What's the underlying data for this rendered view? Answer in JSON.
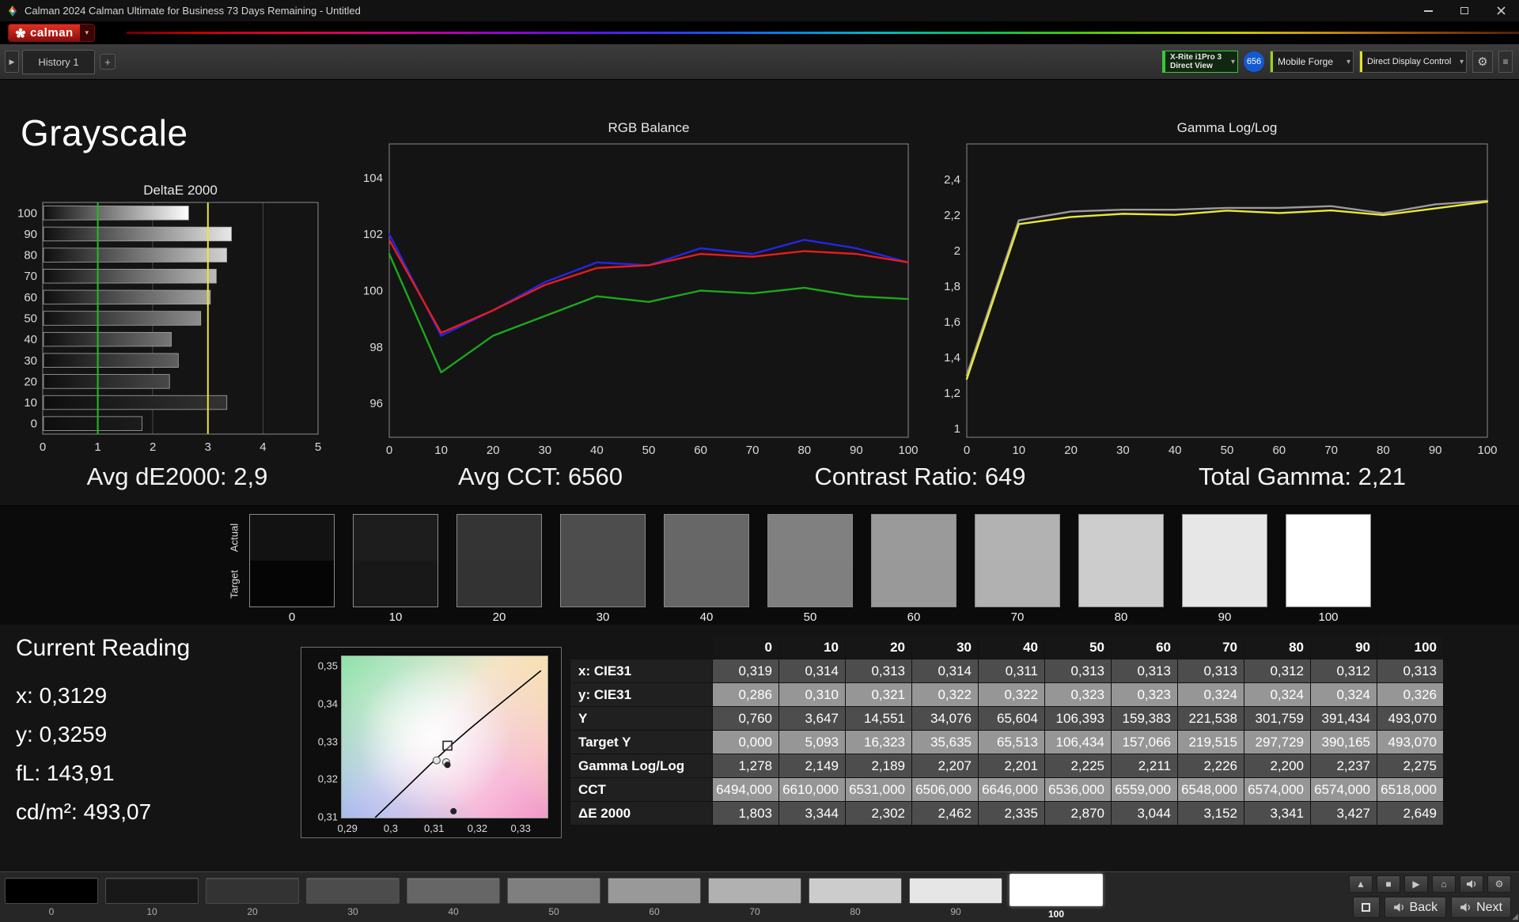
{
  "window": {
    "title": "Calman 2024 Calman Ultimate for Business 73 Days Remaining  - Untitled"
  },
  "brand": {
    "logo_text": "calman"
  },
  "icons": {
    "play": "▶",
    "stop": "■",
    "eject": "▲",
    "home": "⌂",
    "gear": "⚙",
    "menu": "≡",
    "chevron_down": "▾",
    "collapse": "▶",
    "grip": "◢"
  },
  "toolbar": {
    "history_tab": "History 1",
    "add_tab_label": "+",
    "meter_select": {
      "line1": "X-Rite i1Pro 3",
      "line2": "Direct View"
    },
    "meter_badge": "656",
    "source_select": "Mobile Forge",
    "control_select": "Direct Display Control"
  },
  "page": {
    "title": "Grayscale",
    "summary": [
      "Avg dE2000: 2,9",
      "Avg CCT: 6560",
      "Contrast Ratio: 649",
      "Total Gamma: 2,21"
    ]
  },
  "chart_data": [
    {
      "type": "bar",
      "title": "DeltaE 2000",
      "orientation": "horizontal",
      "categories": [
        100,
        90,
        80,
        70,
        60,
        50,
        40,
        30,
        20,
        10,
        0
      ],
      "values": [
        2.649,
        3.427,
        3.341,
        3.152,
        3.044,
        2.87,
        2.335,
        2.462,
        2.302,
        3.344,
        1.803
      ],
      "xlim": [
        0,
        5
      ],
      "xticks": [
        0,
        1,
        2,
        3,
        4,
        5
      ],
      "reference_lines": [
        {
          "x": 1,
          "color": "#1fbf1f"
        },
        {
          "x": 3,
          "color": "#e8e83a"
        }
      ]
    },
    {
      "type": "line",
      "title": "RGB Balance",
      "x": [
        0,
        10,
        20,
        30,
        40,
        50,
        60,
        70,
        80,
        90,
        100
      ],
      "xticks": [
        0,
        10,
        20,
        30,
        40,
        50,
        60,
        70,
        80,
        90,
        100
      ],
      "ylim": [
        94.8,
        105.2
      ],
      "yticks": [
        96,
        98,
        100,
        102,
        104
      ],
      "ytick_labels": [
        "96",
        "98",
        "100",
        "102",
        "104"
      ],
      "series": [
        {
          "name": "green",
          "color": "#1da81d",
          "values": [
            101.3,
            97.1,
            98.4,
            99.1,
            99.8,
            99.6,
            100.0,
            99.9,
            100.1,
            99.8,
            99.7
          ]
        },
        {
          "name": "blue",
          "color": "#2525e8",
          "values": [
            102.0,
            98.4,
            99.3,
            100.3,
            101.0,
            100.9,
            101.5,
            101.3,
            101.8,
            101.5,
            101.0
          ]
        },
        {
          "name": "red",
          "color": "#e81c1c",
          "values": [
            101.8,
            98.5,
            99.3,
            100.2,
            100.8,
            100.9,
            101.3,
            101.2,
            101.4,
            101.3,
            101.0
          ]
        }
      ]
    },
    {
      "type": "line",
      "title": "Gamma Log/Log",
      "x": [
        0,
        10,
        20,
        30,
        40,
        50,
        60,
        70,
        80,
        90,
        100
      ],
      "xticks": [
        0,
        10,
        20,
        30,
        40,
        50,
        60,
        70,
        80,
        90,
        100
      ],
      "ylim": [
        0.95,
        2.6
      ],
      "yticks": [
        1,
        1.2,
        1.4,
        1.6,
        1.8,
        2,
        2.2,
        2.4
      ],
      "ytick_labels": [
        "1",
        "1,2",
        "1,4",
        "1,6",
        "1,8",
        "2",
        "2,2",
        "2,4"
      ],
      "series": [
        {
          "name": "target",
          "color": "#9a9a9a",
          "values": [
            1.3,
            2.17,
            2.22,
            2.23,
            2.23,
            2.24,
            2.24,
            2.25,
            2.21,
            2.26,
            2.28
          ]
        },
        {
          "name": "measured",
          "color": "#e8e83a",
          "values": [
            1.278,
            2.149,
            2.189,
            2.207,
            2.201,
            2.225,
            2.211,
            2.226,
            2.2,
            2.237,
            2.275
          ]
        }
      ]
    },
    {
      "type": "scatter",
      "title": "CIE chromaticity",
      "xlim": [
        0.2885,
        0.336
      ],
      "ylim": [
        0.31,
        0.3528
      ],
      "xticks": [
        0.29,
        0.3,
        0.31,
        0.32,
        0.33
      ],
      "xtick_labels": [
        "0,29",
        "0,3",
        "0,31",
        "0,32",
        "0,33"
      ],
      "yticks": [
        0.35,
        0.34,
        0.33,
        0.32,
        0.31
      ],
      "ytick_labels": [
        "0,35",
        "0,34",
        "0,33",
        "0,32",
        "0,31"
      ],
      "curve": [
        [
          0.2962,
          0.31
        ],
        [
          0.3,
          0.3142
        ],
        [
          0.3045,
          0.3192
        ],
        [
          0.309,
          0.3242
        ],
        [
          0.3135,
          0.329
        ],
        [
          0.318,
          0.3335
        ],
        [
          0.3225,
          0.3378
        ],
        [
          0.327,
          0.342
        ],
        [
          0.3315,
          0.3462
        ],
        [
          0.3345,
          0.349
        ]
      ],
      "target_square": [
        0.3129,
        0.3291
      ],
      "measured_circles": [
        [
          0.3104,
          0.3252
        ],
        [
          0.3126,
          0.3247
        ]
      ],
      "dark_dots": [
        [
          0.3129,
          0.324
        ],
        [
          0.3143,
          0.3117
        ]
      ]
    }
  ],
  "patch_row": {
    "row_labels": [
      "Actual",
      "Target"
    ],
    "levels": [
      {
        "label": "0",
        "actual": "#121212",
        "target": "#050505"
      },
      {
        "label": "10",
        "actual": "#1d1d1d",
        "target": "#181818"
      },
      {
        "label": "20",
        "actual": "#343434",
        "target": "#333333"
      },
      {
        "label": "30",
        "actual": "#4d4d4d",
        "target": "#4c4c4c"
      },
      {
        "label": "40",
        "actual": "#676767",
        "target": "#666666"
      },
      {
        "label": "50",
        "actual": "#808080",
        "target": "#7f7f7f"
      },
      {
        "label": "60",
        "actual": "#9a9a9a",
        "target": "#999999"
      },
      {
        "label": "70",
        "actual": "#b2b2b2",
        "target": "#b1b1b1"
      },
      {
        "label": "80",
        "actual": "#cdcdcd",
        "target": "#cccccc"
      },
      {
        "label": "90",
        "actual": "#e7e7e7",
        "target": "#e6e6e6"
      },
      {
        "label": "100",
        "actual": "#ffffff",
        "target": "#ffffff"
      }
    ]
  },
  "current_reading": {
    "title": "Current Reading",
    "lines": [
      {
        "label": "x:",
        "value": "0,3129"
      },
      {
        "label": "y:",
        "value": "0,3259"
      },
      {
        "label": "fL:",
        "value": "143,91"
      },
      {
        "label": "cd/m²:",
        "value": "493,07"
      }
    ]
  },
  "table": {
    "columns": [
      "0",
      "10",
      "20",
      "30",
      "40",
      "50",
      "60",
      "70",
      "80",
      "90",
      "100"
    ],
    "rows": [
      {
        "label": "x: CIE31",
        "values": [
          "0,319",
          "0,314",
          "0,313",
          "0,314",
          "0,311",
          "0,313",
          "0,313",
          "0,313",
          "0,312",
          "0,312",
          "0,313"
        ]
      },
      {
        "label": "y: CIE31",
        "values": [
          "0,286",
          "0,310",
          "0,321",
          "0,322",
          "0,322",
          "0,323",
          "0,323",
          "0,324",
          "0,324",
          "0,324",
          "0,326"
        ]
      },
      {
        "label": "Y",
        "values": [
          "0,760",
          "3,647",
          "14,551",
          "34,076",
          "65,604",
          "106,393",
          "159,383",
          "221,538",
          "301,759",
          "391,434",
          "493,070"
        ]
      },
      {
        "label": "Target Y",
        "values": [
          "0,000",
          "5,093",
          "16,323",
          "35,635",
          "65,513",
          "106,434",
          "157,066",
          "219,515",
          "297,729",
          "390,165",
          "493,070"
        ]
      },
      {
        "label": "Gamma Log/Log",
        "values": [
          "1,278",
          "2,149",
          "2,189",
          "2,207",
          "2,201",
          "2,225",
          "2,211",
          "2,226",
          "2,200",
          "2,237",
          "2,275"
        ]
      },
      {
        "label": "CCT",
        "values": [
          "6494,000",
          "6610,000",
          "6531,000",
          "6506,000",
          "6646,000",
          "6536,000",
          "6559,000",
          "6548,000",
          "6574,000",
          "6574,000",
          "6518,000"
        ]
      },
      {
        "label": "ΔE 2000",
        "values": [
          "1,803",
          "3,344",
          "2,302",
          "2,462",
          "2,335",
          "2,870",
          "3,044",
          "3,152",
          "3,341",
          "3,427",
          "2,649"
        ]
      }
    ]
  },
  "bottom_bar": {
    "levels": [
      {
        "label": "0",
        "color": "#000000"
      },
      {
        "label": "10",
        "color": "#181818"
      },
      {
        "label": "20",
        "color": "#333333"
      },
      {
        "label": "30",
        "color": "#4c4c4c"
      },
      {
        "label": "40",
        "color": "#666666"
      },
      {
        "label": "50",
        "color": "#7f7f7f"
      },
      {
        "label": "60",
        "color": "#999999"
      },
      {
        "label": "70",
        "color": "#b1b1b1"
      },
      {
        "label": "80",
        "color": "#cccccc"
      },
      {
        "label": "90",
        "color": "#e6e6e6"
      },
      {
        "label": "100",
        "color": "#ffffff",
        "selected": true
      }
    ],
    "back_label": "Back",
    "next_label": "Next"
  }
}
